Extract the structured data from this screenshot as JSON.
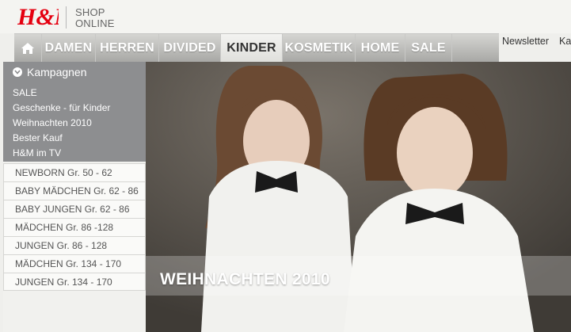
{
  "header": {
    "brand": "H&M",
    "shop_label_line1": "SHOP",
    "shop_label_line2": "ONLINE"
  },
  "nav": {
    "items": [
      {
        "label": "DAMEN"
      },
      {
        "label": "HERREN"
      },
      {
        "label": "DIVIDED"
      },
      {
        "label": "KINDER",
        "active": true
      },
      {
        "label": "KOSMETIK"
      },
      {
        "label": "HOME"
      },
      {
        "label": "SALE"
      }
    ],
    "right_links": [
      "Newsletter",
      "Ka"
    ]
  },
  "sidebar": {
    "campaign_title": "Kampagnen",
    "campaign_links": [
      "SALE",
      "Geschenke - für Kinder",
      "Weihnachten 2010",
      "Bester Kauf",
      "H&M im TV"
    ],
    "categories": [
      "NEWBORN Gr. 50 - 62",
      "BABY MÄDCHEN Gr. 62 - 86",
      "BABY JUNGEN Gr. 62 - 86",
      "MÄDCHEN Gr. 86 -128",
      "JUNGEN Gr. 86 - 128",
      "MÄDCHEN Gr. 134 - 170",
      "JUNGEN Gr. 134 - 170"
    ]
  },
  "hero": {
    "title": "WEIHNACHTEN 2010"
  },
  "colors": {
    "brand_red": "#e50010",
    "nav_grey": "#a8a8a5",
    "campaign_grey": "#8d8e90"
  }
}
